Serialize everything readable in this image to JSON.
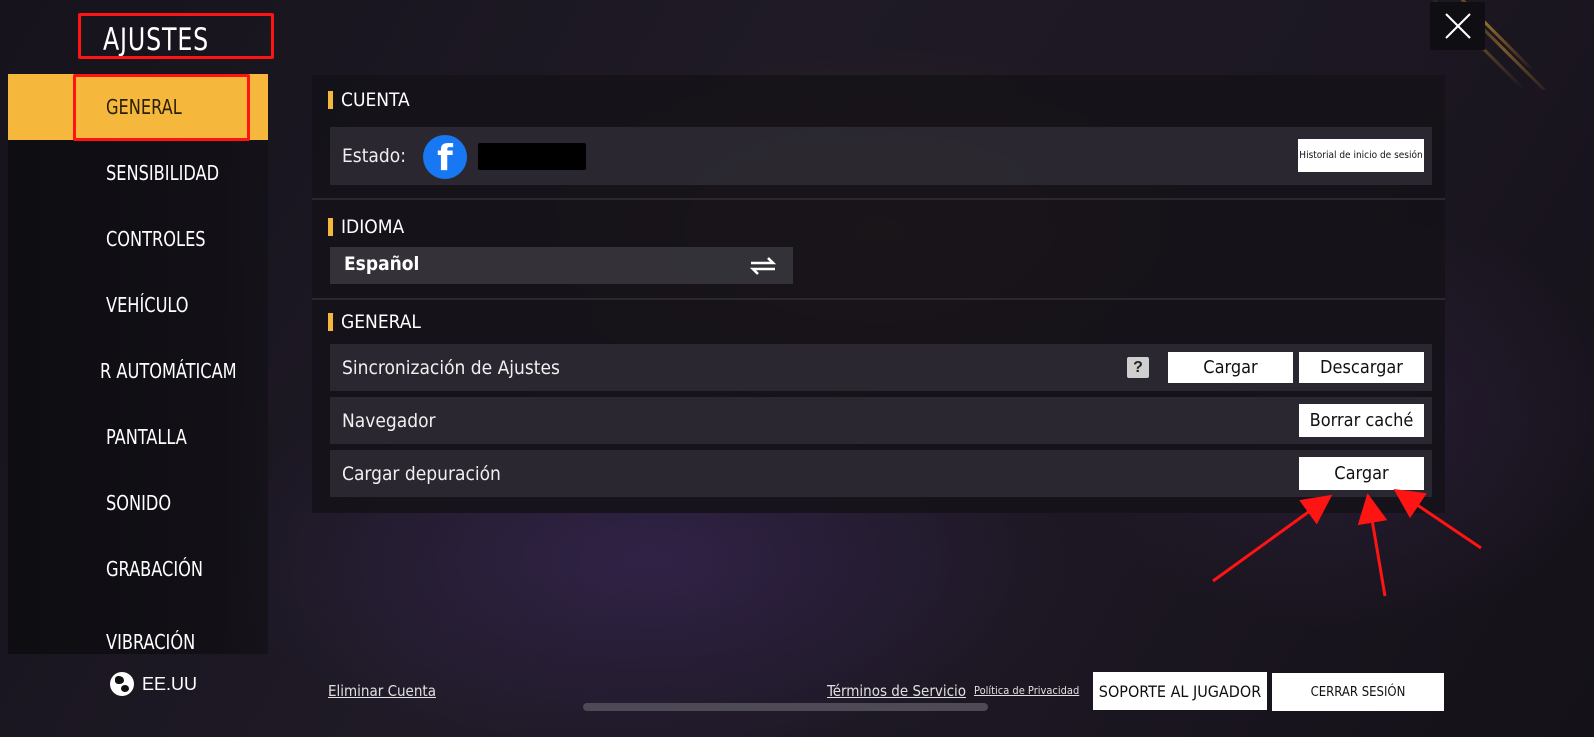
{
  "app": {
    "title": "AJUSTES"
  },
  "sidebar": {
    "items": [
      {
        "label": "GENERAL",
        "active": true
      },
      {
        "label": "SENSIBILIDAD"
      },
      {
        "label": "CONTROLES"
      },
      {
        "label": "VEHÍCULO"
      },
      {
        "label": "R AUTOMÁTICAM"
      },
      {
        "label": "PANTALLA"
      },
      {
        "label": "SONIDO"
      },
      {
        "label": "GRABACIÓN"
      },
      {
        "label": "VIBRACIÓN"
      }
    ],
    "region": {
      "label": "EE.UU",
      "icon": "globe-icon"
    }
  },
  "close": {
    "icon": "close-icon"
  },
  "account": {
    "heading": "CUENTA",
    "status_label": "Estado:",
    "status_icon": "facebook-icon",
    "login_history_button": "Historial de inicio de sesión"
  },
  "language": {
    "heading": "IDIOMA",
    "selected": "Español",
    "icon": "swap-arrows-icon"
  },
  "general": {
    "heading": "GENERAL",
    "sync": {
      "label": "Sincronización de Ajustes",
      "help": "?",
      "upload": "Cargar",
      "download": "Descargar"
    },
    "browser": {
      "label": "Navegador",
      "clear_cache": "Borrar caché"
    },
    "debug": {
      "label": "Cargar depuración",
      "upload": "Cargar"
    }
  },
  "footer": {
    "delete_account": "Eliminar Cuenta",
    "terms": "Términos de Servicio",
    "privacy": "Política de Privacidad",
    "support": "SOPORTE AL JUGADOR",
    "logout": "CERRAR SESIÓN"
  },
  "colors": {
    "accent": "#f5b73c",
    "annotation": "#ff1414",
    "facebook": "#1877f2"
  }
}
